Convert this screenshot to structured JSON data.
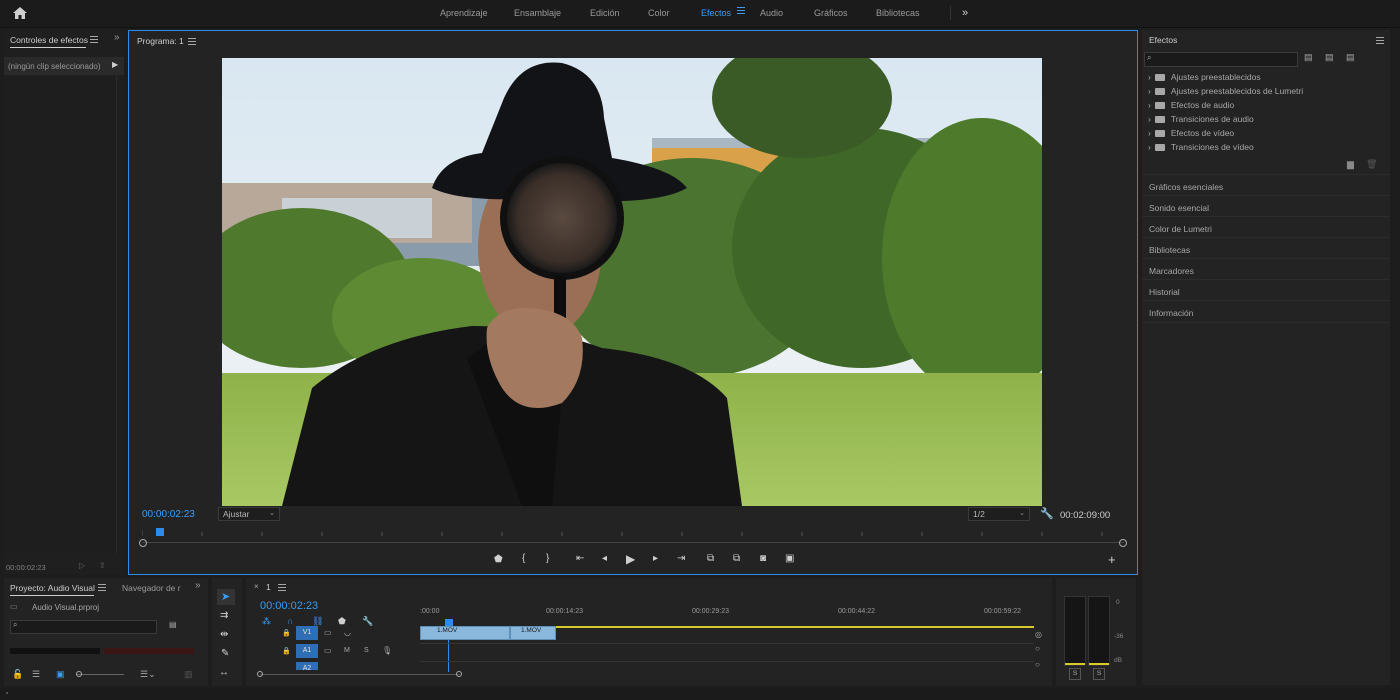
{
  "header": {
    "workspaces": [
      "Aprendizaje",
      "Ensamblaje",
      "Edición",
      "Color",
      "Efectos",
      "Audio",
      "Gráficos",
      "Bibliotecas"
    ],
    "active_workspace": "Efectos"
  },
  "effect_controls": {
    "tab_label": "Controles de efectos",
    "no_clip_text": "(ningún clip seleccionado)",
    "timecode": "00:00:02:23"
  },
  "program": {
    "tab_label": "Programa: 1",
    "current_timecode": "00:00:02:23",
    "fit_option": "Ajustar",
    "resolution_option": "1/2",
    "duration_timecode": "00:02:09:00"
  },
  "effects": {
    "tab_label": "Efectos",
    "search_placeholder": "",
    "tree": [
      "Ajustes preestablecidos",
      "Ajustes preestablecidos de Lumetri",
      "Efectos de audio",
      "Transiciones de audio",
      "Efectos de vídeo",
      "Transiciones de vídeo"
    ],
    "sections": [
      "Gráficos esenciales",
      "Sonido esencial",
      "Color de Lumetri",
      "Bibliotecas",
      "Marcadores",
      "Historial",
      "Información"
    ]
  },
  "project": {
    "tab_label": "Proyecto: Audio Visual",
    "navigator_tab_label": "Navegador de r",
    "file_name": "Audio Visual.prproj"
  },
  "timeline": {
    "sequence_name": "1",
    "timecode": "00:00:02:23",
    "ruler_labels": [
      ":00:00",
      "00:00:14:23",
      "00:00:29:23",
      "00:00:44:22",
      "00:00:59:22"
    ],
    "tracks": {
      "v1": "V1",
      "a1": "A1",
      "a2": "A2",
      "mute": "M",
      "solo": "S"
    },
    "clips": [
      "1.MOV",
      "1.MOV"
    ]
  },
  "meters": {
    "scale": [
      "0",
      "-36",
      "dB"
    ],
    "solo_labels": [
      "S",
      "S"
    ]
  },
  "colors": {
    "accent": "#3b9cf0",
    "panel": "#232323",
    "background": "#1d1d1d",
    "clip": "#8ab7dc",
    "playhead": "#2d8ceb",
    "work_area": "#d9c92e"
  }
}
